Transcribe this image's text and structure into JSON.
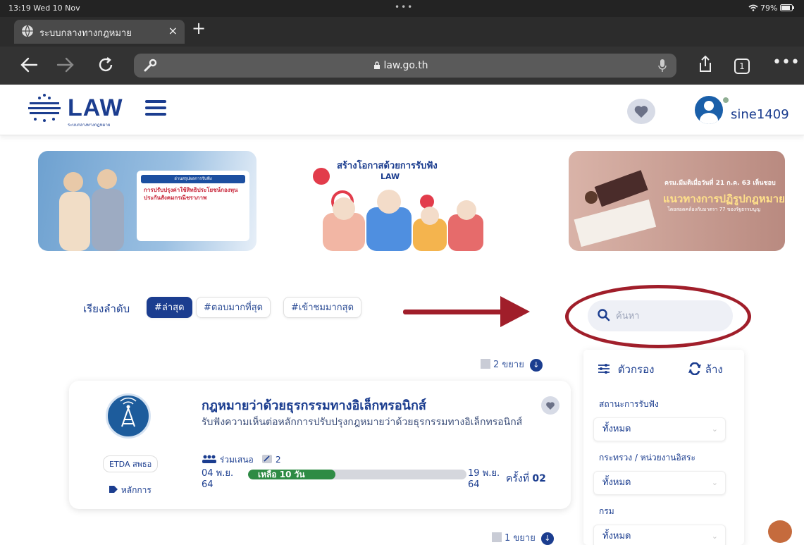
{
  "status_bar": {
    "time": "13:19  Wed 10 Nov",
    "dots": "•••",
    "battery": "79%"
  },
  "browser": {
    "tab_title": "ระบบกลางทางกฎหมาย",
    "tab_close": "×",
    "new_tab": "+",
    "url": "law.go.th",
    "tabs_count": "1"
  },
  "header": {
    "logo_text": "LAW",
    "logo_subtitle": "ระบบกลางทางกฎหมาย",
    "username": "sine1409"
  },
  "banners": [
    {
      "header": "อ่านสรุปผลการรับฟัง",
      "text": "การปรับปรุงค่าใช้สิทธิประโยชน์กองทุนประกันสังคมกรณีชราภาพ"
    },
    {
      "title": "สร้างโอกาสด้วยการรับฟัง",
      "mini": "LAW"
    },
    {
      "line1": "ครม.มีมติเมื่อวันที่ 21 ก.ค. 63 เห็นชอบ",
      "line2": "แนวทางการปฏิรูปกฎหมาย",
      "line3": "โดยสอดคล้องกับมาตรา 77 ของรัฐธรรมนูญ"
    }
  ],
  "sort": {
    "label": "เรียงลำดับ",
    "options": [
      "#ล่าสุด",
      "#ตอบมากที่สุด",
      "#เข้าชมมากสุด"
    ],
    "active_index": 0
  },
  "search": {
    "placeholder": "ค้นหา"
  },
  "list": {
    "expand_top": "2 ขยาย",
    "expand_bottom": "1 ขยาย",
    "items": [
      {
        "title": "กฎหมายว่าด้วยธุรกรรมทางอิเล็กทรอนิกส์",
        "description": "รับฟังความเห็นต่อหลักการปรับปรุงกฎหมายว่าด้วยธุรกรรมทางอิเล็กทรอนิกส์",
        "agency": "ETDA สพธอ",
        "principle_label": "หลักการ",
        "participants_label": "ร่วมเสนอ",
        "comments_count": "2",
        "start_date": "04 พ.ย.",
        "start_year": "64",
        "end_date": "19 พ.ย.",
        "end_year": "64",
        "remaining": "เหลือ 10 วัน",
        "progress_fraction": 0.4,
        "round_label": "ครั้งที่",
        "round_number": "02"
      }
    ]
  },
  "filter": {
    "title": "ตัวกรอง",
    "reset": "ล้าง",
    "groups": [
      {
        "label": "สถานะการรับฟัง",
        "value": "ทั้งหมด"
      },
      {
        "label": "กระทรวง / หน่วยงานอิสระ",
        "value": "ทั้งหมด"
      },
      {
        "label": "กรม",
        "value": "ทั้งหมด"
      }
    ]
  },
  "colors": {
    "primary": "#1b3d8f",
    "annotation": "#a01e2a",
    "progress": "#2e8b44"
  }
}
